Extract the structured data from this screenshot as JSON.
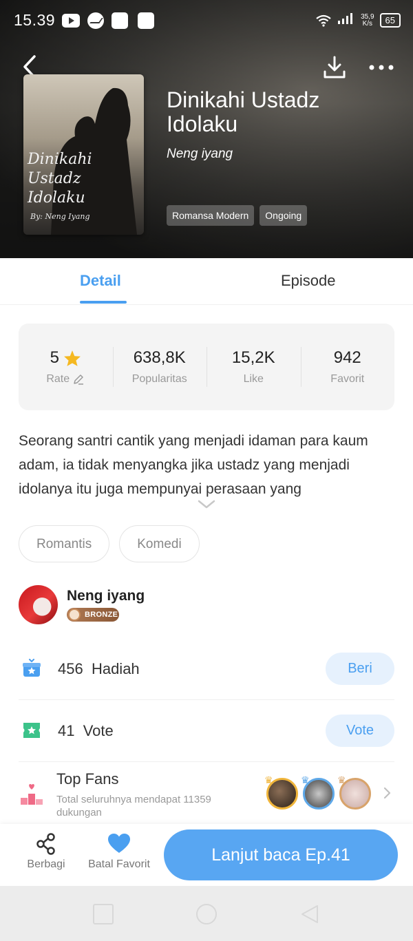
{
  "status_bar": {
    "time": "15.39",
    "net_speed_value": "35,9",
    "net_speed_unit": "K/s",
    "battery": "65"
  },
  "book": {
    "title": "Dinikahi Ustadz Idolaku",
    "author": "Neng iyang",
    "cover_title": "Dinikahi Ustadz Idolaku",
    "cover_author": "By: Neng Iyang",
    "genres": [
      "Romansa Modern",
      "Ongoing"
    ]
  },
  "tabs": {
    "detail": "Detail",
    "episode": "Episode"
  },
  "stats": {
    "rate": {
      "value": "5",
      "label": "Rate"
    },
    "popularity": {
      "value": "638,8K",
      "label": "Popularitas"
    },
    "like": {
      "value": "15,2K",
      "label": "Like"
    },
    "favorite": {
      "value": "942",
      "label": "Favorit"
    }
  },
  "synopsis": "Seorang santri cantik yang menjadi idaman para kaum adam, ia tidak menyangka jika ustadz yang menjadi idolanya itu juga mempunyai perasaan yang",
  "keywords": [
    "Romantis",
    "Komedi"
  ],
  "author_card": {
    "name": "Neng iyang",
    "badge": "BRONZE"
  },
  "gift": {
    "count": "456",
    "label": "Hadiah",
    "button": "Beri"
  },
  "vote": {
    "count": "41",
    "label": "Vote",
    "button": "Vote"
  },
  "top_fans": {
    "title": "Top Fans",
    "subtitle": "Total seluruhnya mendapat 11359 dukungan"
  },
  "bottom_bar": {
    "share": "Berbagi",
    "favorite": "Batal Favorit",
    "cta": "Lanjut baca Ep.41"
  },
  "colors": {
    "accent": "#4a9ff0",
    "cta": "#58a6f2",
    "star": "#f5b820",
    "gift": "#4a9ff0",
    "vote": "#3cc38a",
    "fav_heart": "#4a9ff0"
  }
}
